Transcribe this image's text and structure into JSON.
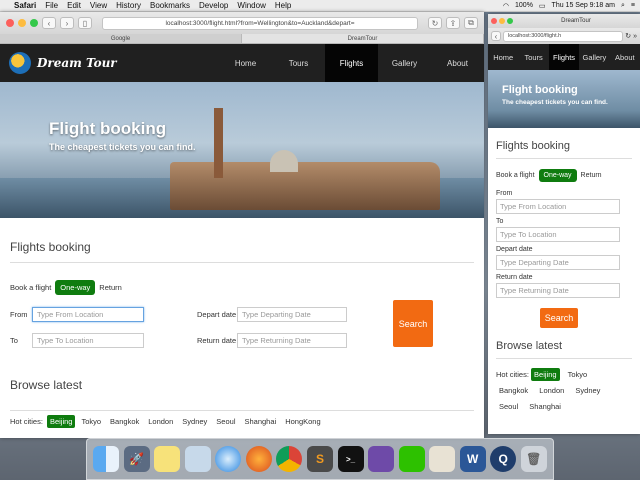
{
  "menubar": {
    "apple": "",
    "items": [
      "Safari",
      "File",
      "Edit",
      "View",
      "History",
      "Bookmarks",
      "Develop",
      "Window",
      "Help"
    ],
    "battery": "100%",
    "clock": "Thu 15 Sep 9:18 am"
  },
  "main_window": {
    "url": "localhost:3000/flight.html?from=Wellington&to=Auckland&depart=",
    "tabs": [
      "Google",
      "DreamTour"
    ],
    "brand": "Dream Tour",
    "nav": [
      "Home",
      "Tours",
      "Flights",
      "Gallery",
      "About"
    ],
    "active_nav": "Flights",
    "hero_title": "Flight booking",
    "hero_subtitle": "The cheapest tickets you can find.",
    "section_title": "Flights booking",
    "book_label": "Book a flight",
    "one_way": "One-way",
    "return": "Return",
    "from_label": "From",
    "from_placeholder": "Type From Location",
    "to_label": "To",
    "to_placeholder": "Type To Location",
    "depart_label": "Depart date",
    "depart_placeholder": "Type Departing Date",
    "return_label": "Return date",
    "return_placeholder": "Type Returning Date",
    "search_button": "Search",
    "browse_title": "Browse latest",
    "hot_cities_label": "Hot cities:",
    "cities": [
      "Beijing",
      "Tokyo",
      "Bangkok",
      "London",
      "Sydney",
      "Seoul",
      "Shanghai",
      "HongKong"
    ]
  },
  "mobile_window": {
    "tab_title": "DreamTour",
    "url": "localhost:3000/flight.h",
    "nav": [
      "Home",
      "Tours",
      "Flights",
      "Gallery",
      "About"
    ],
    "active_nav": "Flights",
    "hero_title": "Flight booking",
    "hero_subtitle": "The cheapest tickets you can find.",
    "section_title": "Flights booking",
    "book_label": "Book a flight",
    "one_way": "One-way",
    "return": "Return",
    "from_label": "From",
    "from_placeholder": "Type From Location",
    "to_label": "To",
    "to_placeholder": "Type To Location",
    "depart_label": "Depart date",
    "depart_placeholder": "Type Departing Date",
    "return_label": "Return date",
    "return_placeholder": "Type Returning Date",
    "search_button": "Search",
    "browse_title": "Browse latest",
    "hot_cities_label": "Hot cities:",
    "cities": [
      "Beijing",
      "Tokyo",
      "Bangkok",
      "London",
      "Sydney",
      "Seoul",
      "Shanghai"
    ]
  },
  "colors": {
    "accent_green": "#0f7c0f",
    "search_orange": "#f26a12",
    "nav_dark": "#202020"
  },
  "dock_icons": [
    "finder-icon",
    "launchpad-icon",
    "notes-icon",
    "preview-icon",
    "safari-icon",
    "firefox-icon",
    "chrome-icon",
    "sublime-icon",
    "terminal-icon",
    "github-icon",
    "wechat-icon",
    "photos-icon",
    "word-icon",
    "quicktime-icon",
    "trash-icon"
  ]
}
